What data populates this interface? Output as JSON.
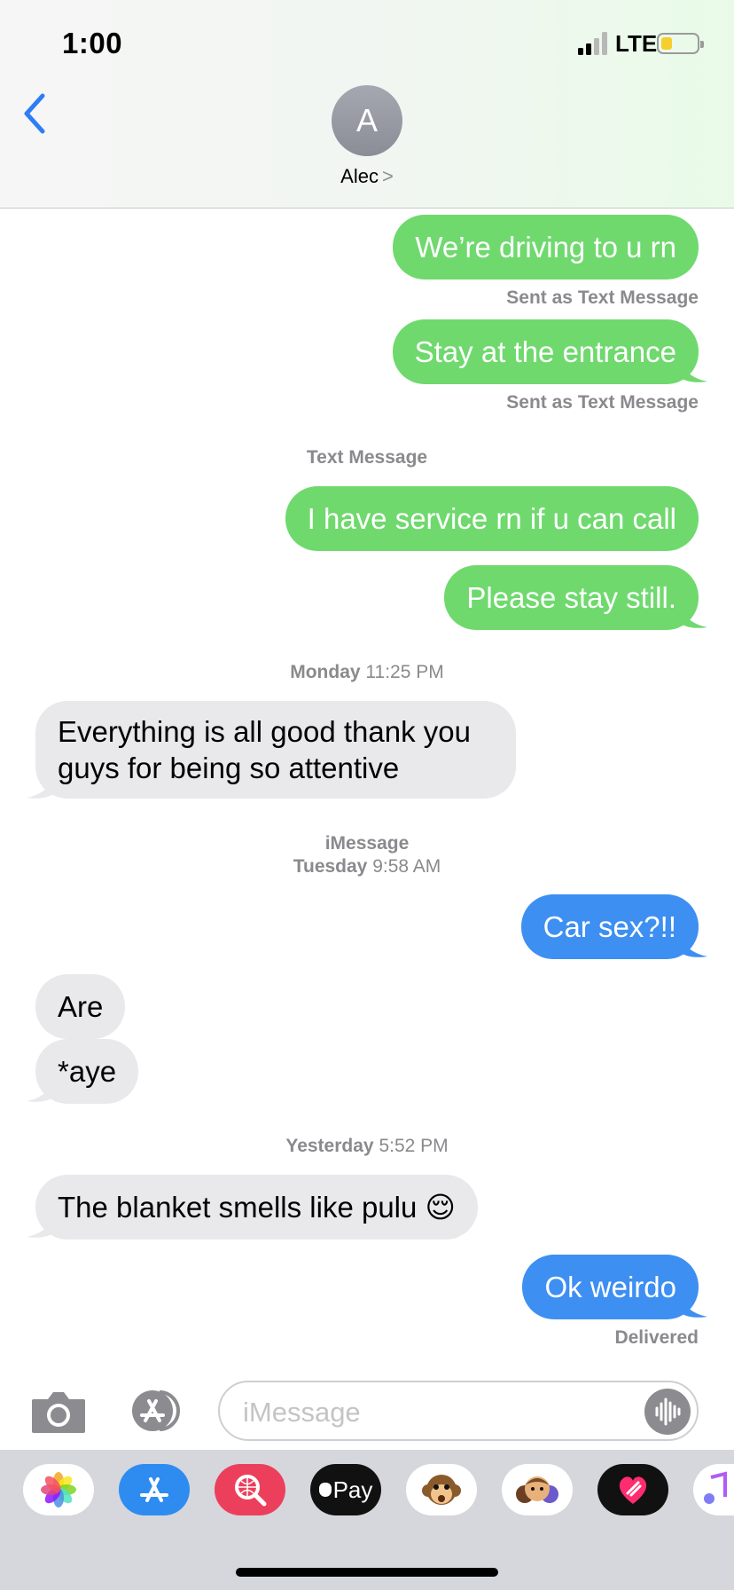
{
  "status_bar": {
    "time": "1:00",
    "network": "LTE"
  },
  "header": {
    "avatar_initial": "A",
    "contact_name": "Alec",
    "contact_chevron": ">"
  },
  "messages": [
    {
      "text": "We’re driving to u rn",
      "direction": "outgoing",
      "type": "sms"
    },
    {
      "text": "Stay at the entrance",
      "direction": "outgoing",
      "type": "sms"
    },
    {
      "text": "I have service rn if u can call",
      "direction": "outgoing",
      "type": "sms"
    },
    {
      "text": "Please stay still.",
      "direction": "outgoing",
      "type": "sms"
    },
    {
      "line1": "Everything is all good thank you",
      "line2": "guys for being so attentive",
      "direction": "incoming"
    },
    {
      "text": "Car sex?!!",
      "direction": "outgoing",
      "type": "imessage"
    },
    {
      "text": "Are",
      "direction": "incoming"
    },
    {
      "text": "*aye",
      "direction": "incoming"
    },
    {
      "text": "The blanket smells like pulu 😌",
      "direction": "incoming"
    },
    {
      "text": "Ok weirdo",
      "direction": "outgoing",
      "type": "imessage"
    }
  ],
  "captions": {
    "sent_as_text_1": "Sent as Text Message",
    "sent_as_text_2": "Sent as Text Message",
    "delivered": "Delivered"
  },
  "separators": {
    "text_message": "Text Message",
    "monday_day": "Monday",
    "monday_time": "11:25 PM",
    "imessage": "iMessage",
    "tuesday_day": "Tuesday",
    "tuesday_time": "9:58 AM",
    "yesterday_day": "Yesterday",
    "yesterday_time": "5:52 PM"
  },
  "input": {
    "placeholder": "iMessage"
  },
  "apps": [
    {
      "name": "photos",
      "icon": "photos-icon"
    },
    {
      "name": "app-store",
      "icon": "app-store-icon"
    },
    {
      "name": "images-search",
      "icon": "image-search-icon"
    },
    {
      "name": "apple-pay",
      "icon": "apple-pay-icon",
      "label": "Pay"
    },
    {
      "name": "animoji",
      "icon": "monkey-icon"
    },
    {
      "name": "memoji",
      "icon": "memoji-icon"
    },
    {
      "name": "digital-touch",
      "icon": "heart-icon"
    },
    {
      "name": "music",
      "icon": "music-icon"
    }
  ],
  "colors": {
    "sms_bubble": "#6fd96e",
    "imessage_bubble": "#3d8ff2",
    "incoming_bubble": "#e9e9eb",
    "accent": "#2f7df6"
  }
}
